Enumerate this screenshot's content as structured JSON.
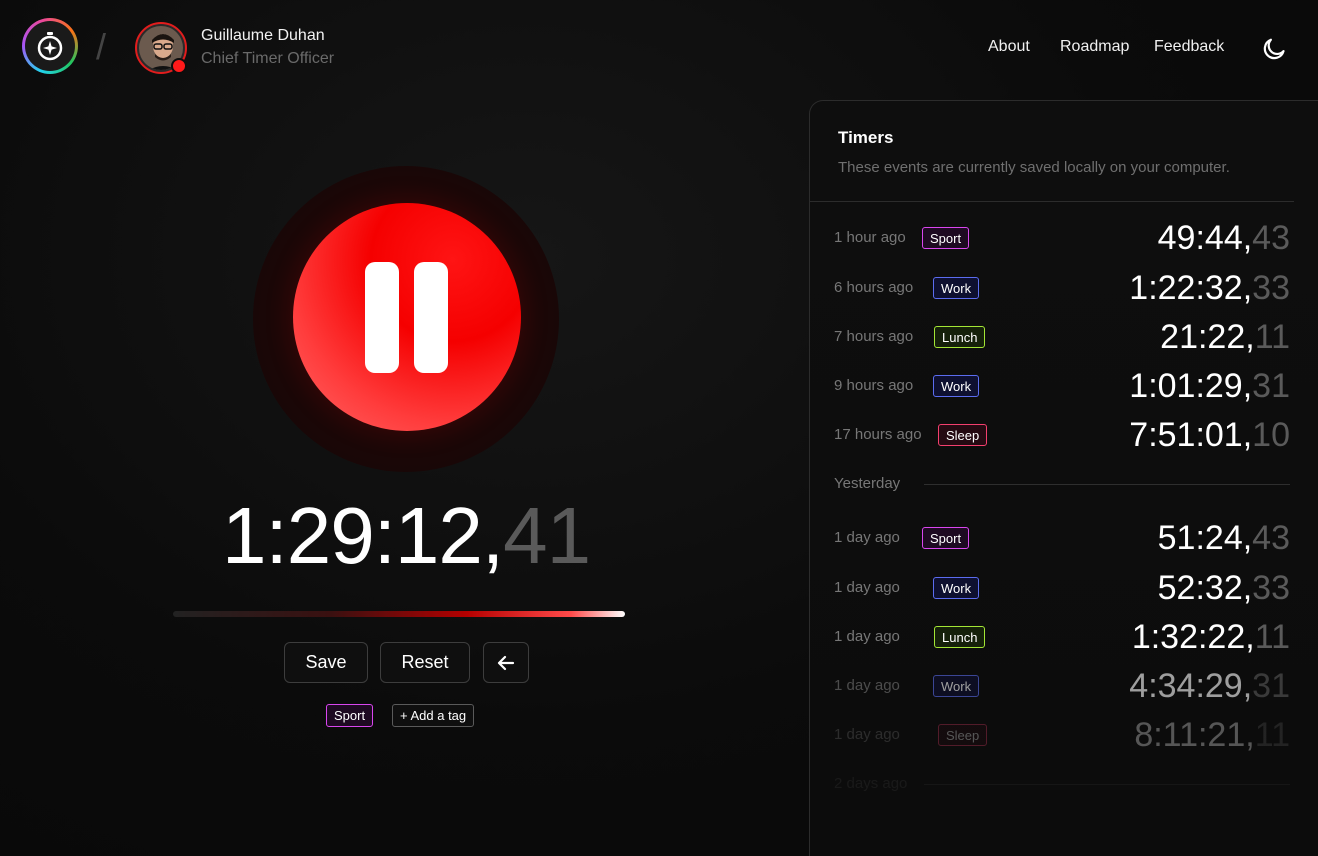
{
  "header": {
    "separator": "/",
    "user_name": "Guillaume Duhan",
    "user_role": "Chief Timer Officer",
    "nav": {
      "about": "About",
      "roadmap": "Roadmap",
      "feedback": "Feedback"
    }
  },
  "timer": {
    "main": "1:29:12,",
    "fraction": "41",
    "progress_fraction": 1.0,
    "accent_color": "#ff0000"
  },
  "controls": {
    "save_label": "Save",
    "reset_label": "Reset",
    "back_icon": "arrow-left-icon"
  },
  "tags": {
    "current": "Sport",
    "add_label": "+ Add a tag"
  },
  "panel": {
    "title": "Timers",
    "subtitle": "These events are currently saved locally on your computer.",
    "today": [
      {
        "ago": "1 hour ago",
        "tag": "Sport",
        "duration": "49:44,",
        "fraction": "43"
      },
      {
        "ago": "6 hours ago",
        "tag": "Work",
        "duration": "1:22:32,",
        "fraction": "33"
      },
      {
        "ago": "7 hours ago",
        "tag": "Lunch",
        "duration": "21:22,",
        "fraction": "11"
      },
      {
        "ago": "9 hours ago",
        "tag": "Work",
        "duration": "1:01:29,",
        "fraction": "31"
      },
      {
        "ago": "17 hours ago",
        "tag": "Sleep",
        "duration": "7:51:01,",
        "fraction": "10"
      }
    ],
    "yesterday_label": "Yesterday",
    "yesterday": [
      {
        "ago": "1 day ago",
        "tag": "Sport",
        "duration": "51:24,",
        "fraction": "43"
      },
      {
        "ago": "1 day ago",
        "tag": "Work",
        "duration": "52:32,",
        "fraction": "33"
      },
      {
        "ago": "1 day ago",
        "tag": "Lunch",
        "duration": "1:32:22,",
        "fraction": "11"
      },
      {
        "ago": "1 day ago",
        "tag": "Work",
        "duration": "4:34:29,",
        "fraction": "31"
      },
      {
        "ago": "1 day ago",
        "tag": "Sleep",
        "duration": "8:11:21,",
        "fraction": "11"
      }
    ],
    "older_label": "2 days ago"
  },
  "colors": {
    "sport": "#d946ef",
    "work": "#5b6cf0",
    "lunch": "#a3e635",
    "sleep": "#f43f6e"
  }
}
